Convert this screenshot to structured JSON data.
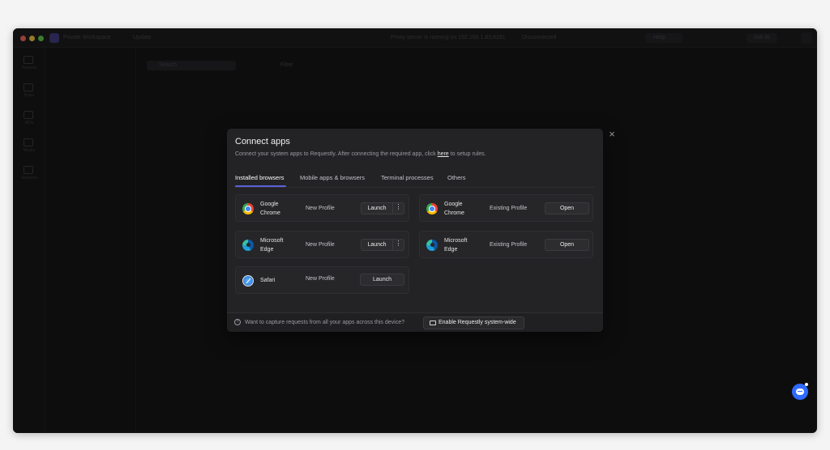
{
  "modal": {
    "title": "Connect apps",
    "desc_before": "Connect your system apps to Requestly. After connecting the required app, click",
    "desc_link": "here",
    "desc_after": "to setup rules.",
    "close_icon": "×",
    "tabs": [
      {
        "label": "Installed browsers",
        "active": true
      },
      {
        "label": "Mobile apps & browsers",
        "active": false
      },
      {
        "label": "Terminal processes",
        "active": false
      },
      {
        "label": "Others",
        "active": false
      }
    ],
    "new_profiles": [
      {
        "icon": "chrome-icon",
        "name_line1": "Google",
        "name_line2": "Chrome",
        "profile": "New Profile",
        "button": "Launch",
        "more": "⋮"
      },
      {
        "icon": "edge-icon",
        "name_line1": "Microsoft",
        "name_line2": "Edge",
        "profile": "New Profile",
        "button": "Launch",
        "more": "⋮"
      },
      {
        "icon": "safari-icon",
        "name_line1": "Safari",
        "name_line2": "",
        "profile": "New Profile",
        "button": "Launch"
      }
    ],
    "existing_profiles": [
      {
        "icon": "chrome-icon",
        "name_line1": "Google",
        "name_line2": "Chrome",
        "profile": "Existing Profile",
        "button": "Open"
      },
      {
        "icon": "edge-icon",
        "name_line1": "Microsoft",
        "name_line2": "Edge",
        "profile": "Existing Profile",
        "button": "Open"
      }
    ],
    "footer": {
      "info_icon": "?",
      "text": "Want to capture requests from all your apps across this device?",
      "button": "Enable Requestly system-wide"
    }
  },
  "background": {
    "workspace": "Private Workspace",
    "nav_label": "Update",
    "center_title": "Proxy server is running on 192.168.1.83:8281",
    "center_extra": "Disconnected",
    "right_a": "Help",
    "right_b": "Ask AI",
    "search_placeholder": "Search",
    "filter_label": "Filter",
    "sidebar_labels": [
      "Network",
      "Rules",
      "APIs",
      "Mocks",
      "Sessions"
    ]
  },
  "colors": {
    "accent": "#5a63d8",
    "chat_fab": "#2f6bff",
    "modal_bg": "#232325",
    "app_bg": "#141415"
  }
}
